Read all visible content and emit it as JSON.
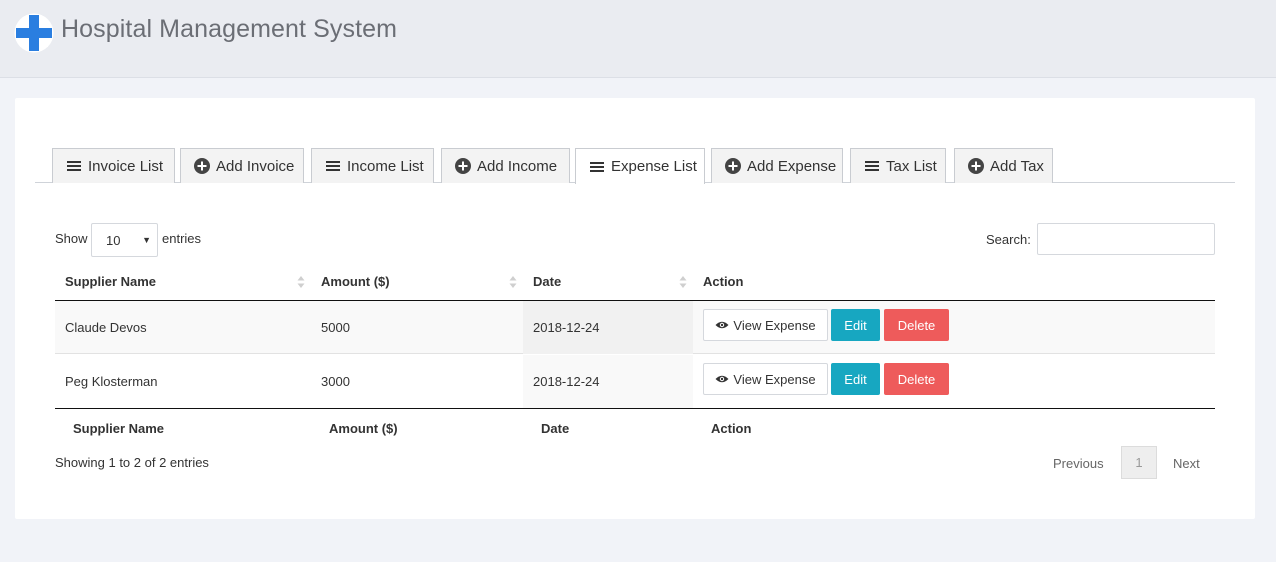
{
  "app": {
    "title": "Hospital Management System"
  },
  "colors": {
    "accent": "#17a7c1",
    "danger": "#ee5b5b",
    "logo_blue": "#2a7ee0"
  },
  "tabs": [
    {
      "label": "Invoice List",
      "icon": "list-icon"
    },
    {
      "label": "Add Invoice",
      "icon": "plus-circle-icon"
    },
    {
      "label": "Income List",
      "icon": "list-icon"
    },
    {
      "label": "Add Income",
      "icon": "plus-circle-icon"
    },
    {
      "label": "Expense List",
      "icon": "list-icon",
      "active": true
    },
    {
      "label": "Add Expense",
      "icon": "plus-circle-icon"
    },
    {
      "label": "Tax List",
      "icon": "list-icon"
    },
    {
      "label": "Add Tax",
      "icon": "plus-circle-icon"
    }
  ],
  "table_controls": {
    "show_label": "Show",
    "entries_value": "10",
    "entries_label": "entries",
    "search_label": "Search:",
    "search_value": ""
  },
  "table": {
    "columns": [
      "Supplier Name",
      "Amount ($)",
      "Date",
      "Action"
    ],
    "rows": [
      {
        "supplier": "Claude Devos",
        "amount": "5000",
        "date": "2018-12-24"
      },
      {
        "supplier": "Peg Klosterman",
        "amount": "3000",
        "date": "2018-12-24"
      }
    ],
    "actions": {
      "view": "View Expense",
      "edit": "Edit",
      "delete": "Delete"
    }
  },
  "footer": {
    "info": "Showing 1 to 2 of 2 entries",
    "previous": "Previous",
    "page": "1",
    "next": "Next"
  }
}
